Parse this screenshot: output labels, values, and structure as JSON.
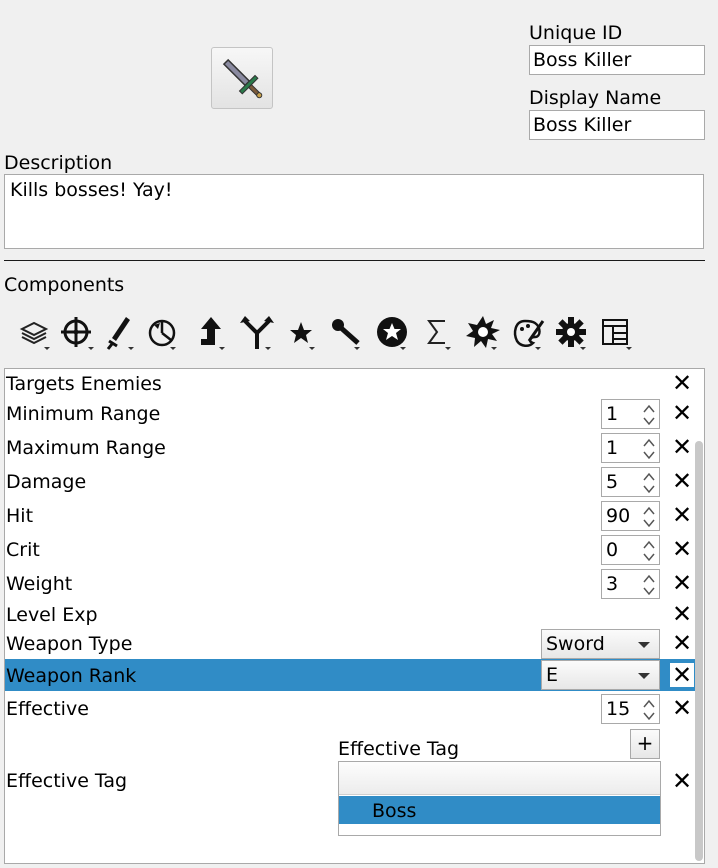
{
  "header": {
    "unique_id_label": "Unique ID",
    "unique_id_value": "Boss Killer",
    "display_name_label": "Display Name",
    "display_name_value": "Boss Killer"
  },
  "description": {
    "label": "Description",
    "value": "Kills bosses! Yay!"
  },
  "components": {
    "label": "Components",
    "toolbar": [
      "layers-icon",
      "crosshair-icon",
      "sword-icon",
      "pie-icon",
      "arrow-up-icon",
      "fork-icon",
      "star-icon",
      "wand-icon",
      "badge-star-icon",
      "sigma-icon",
      "burst-icon",
      "palette-icon",
      "gear-icon",
      "layout-icon"
    ]
  },
  "rows": [
    {
      "name": "Targets Enemies"
    },
    {
      "name": "Minimum Range",
      "value": "1"
    },
    {
      "name": "Maximum Range",
      "value": "1"
    },
    {
      "name": "Damage",
      "value": "5"
    },
    {
      "name": "Hit",
      "value": "90"
    },
    {
      "name": "Crit",
      "value": "0"
    },
    {
      "name": "Weight",
      "value": "3"
    },
    {
      "name": "Level Exp"
    },
    {
      "name": "Weapon Type",
      "value": "Sword"
    },
    {
      "name": "Weapon Rank",
      "value": "E"
    },
    {
      "name": "Effective",
      "value": "15"
    },
    {
      "name": "Effective Tag",
      "sub_label": "Effective Tag",
      "add": "+",
      "list_item": "Boss"
    }
  ],
  "colors": {
    "selection": "#308cc6",
    "window": "#f0f0f0"
  }
}
